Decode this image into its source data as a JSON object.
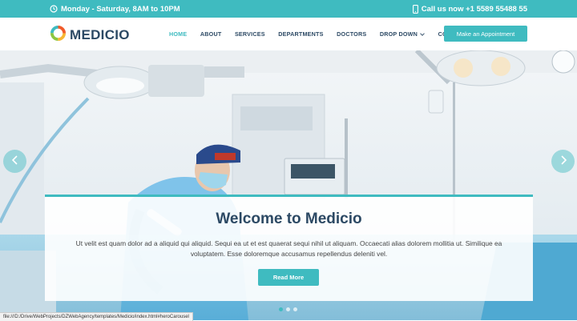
{
  "topbar": {
    "hours": "Monday - Saturday, 8AM to 10PM",
    "phone": "Call us now +1 5589 55488 55"
  },
  "logo": {
    "text": "MEDICIO"
  },
  "nav": {
    "items": [
      {
        "label": "HOME",
        "active": true
      },
      {
        "label": "ABOUT"
      },
      {
        "label": "SERVICES"
      },
      {
        "label": "DEPARTMENTS"
      },
      {
        "label": "DOCTORS"
      },
      {
        "label": "DROP DOWN"
      },
      {
        "label": "CONTACT"
      }
    ],
    "cta": "Make an Appointment"
  },
  "hero": {
    "title": "Welcome to Medicio",
    "text": "Ut velit est quam dolor ad a aliquid qui aliquid. Sequi ea ut et est quaerat sequi nihil ut aliquam. Occaecati alias dolorem mollitia ut. Similique ea voluptatem. Esse doloremque accusamus repellendus deleniti vel.",
    "button": "Read More",
    "slides": 3,
    "active_slide": 1
  },
  "statusbar": {
    "url": "file:///D:/Drive/WebProjects/DZWebAgency/templates/Medicio/index.html#heroCarousel"
  },
  "colors": {
    "accent": "#3fbbc0",
    "heading": "#2c4964"
  }
}
